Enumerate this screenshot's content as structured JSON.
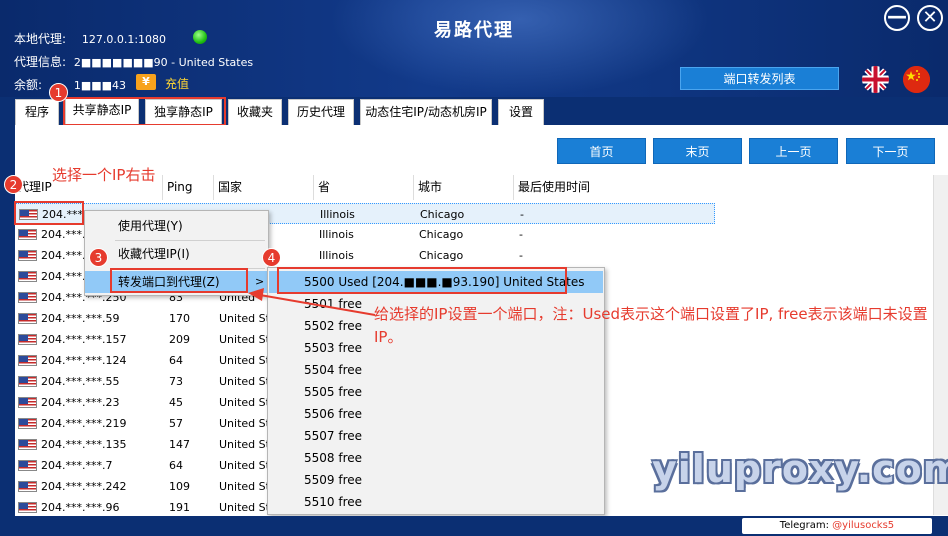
{
  "header": {
    "title": "易路代理",
    "local_proxy_label": "本地代理:",
    "local_proxy_value": "127.0.0.1:1080",
    "proxy_info_label": "代理信息:",
    "proxy_info_value": "2■■■■■■■90 - United States",
    "balance_label": "余额:",
    "balance_value": "1■■■43",
    "coin_symbol": "¥",
    "recharge": "充值",
    "port_forward_list": "端口转发列表",
    "minimize": "—",
    "close": "✕"
  },
  "tabs": [
    "程序",
    "共享静态IP",
    "独享静态IP",
    "收藏夹",
    "历史代理",
    "动态住宅IP/动态机房IP",
    "设置"
  ],
  "pagination": [
    "首页",
    "末页",
    "上一页",
    "下一页"
  ],
  "hint": "选择一个IP右击",
  "columns": [
    "代理IP",
    "Ping",
    "国家",
    "省",
    "城市",
    "最后使用时间"
  ],
  "rows": [
    {
      "ip": "204.***",
      "ping": "",
      "country": "es",
      "state": "Illinois",
      "city": "Chicago",
      "last": "-"
    },
    {
      "ip": "204.***.",
      "ping": "",
      "country": "es",
      "state": "Illinois",
      "city": "Chicago",
      "last": "-"
    },
    {
      "ip": "204.***.",
      "ping": "",
      "country": "es",
      "state": "Illinois",
      "city": "Chicago",
      "last": "-"
    },
    {
      "ip": "204.***.",
      "ping": "",
      "country": "",
      "state": "",
      "city": "",
      "last": ""
    },
    {
      "ip": "204.***.***.250",
      "ping": "83",
      "country": "United",
      "state": "",
      "city": "",
      "last": ""
    },
    {
      "ip": "204.***.***.59",
      "ping": "170",
      "country": "United Sta",
      "state": "",
      "city": "",
      "last": ""
    },
    {
      "ip": "204.***.***.157",
      "ping": "209",
      "country": "United Sta",
      "state": "",
      "city": "",
      "last": ""
    },
    {
      "ip": "204.***.***.124",
      "ping": "64",
      "country": "United Sta",
      "state": "",
      "city": "",
      "last": ""
    },
    {
      "ip": "204.***.***.55",
      "ping": "73",
      "country": "United Sta",
      "state": "",
      "city": "",
      "last": ""
    },
    {
      "ip": "204.***.***.23",
      "ping": "45",
      "country": "United Sta",
      "state": "",
      "city": "",
      "last": ""
    },
    {
      "ip": "204.***.***.219",
      "ping": "57",
      "country": "United Sta",
      "state": "",
      "city": "",
      "last": ""
    },
    {
      "ip": "204.***.***.135",
      "ping": "147",
      "country": "United Sta",
      "state": "",
      "city": "",
      "last": ""
    },
    {
      "ip": "204.***.***.7",
      "ping": "64",
      "country": "United Sta",
      "state": "",
      "city": "",
      "last": ""
    },
    {
      "ip": "204.***.***.242",
      "ping": "109",
      "country": "United Sta",
      "state": "",
      "city": "",
      "last": ""
    },
    {
      "ip": "204.***.***.96",
      "ping": "191",
      "country": "United Sta",
      "state": "",
      "city": "",
      "last": ""
    }
  ],
  "context_menu": {
    "items": [
      "使用代理(Y)",
      "收藏代理IP(I)",
      "转发端口到代理(Z)"
    ],
    "arrow": ">"
  },
  "submenu": [
    "5500 Used [204.■■■.■93.190] United States",
    "5501 free",
    "5502 free",
    "5503 free",
    "5504 free",
    "5505 free",
    "5506 free",
    "5507 free",
    "5508 free",
    "5509 free",
    "5510 free"
  ],
  "badges": [
    "1",
    "2",
    "3",
    "4"
  ],
  "annotation": "给选择的IP设置一个端口，注：Used表示这个端口设置了IP, free表示该端口未设置IP。",
  "watermark": "yiluproxy.com",
  "footer": {
    "telegram_label": "Telegram: ",
    "telegram_handle": "@yilusocks5"
  },
  "colors": {
    "header_bg": "#0a2a6c",
    "accent_blue": "#1a7fd6",
    "annotation_red": "#e63b2e",
    "menu_hover": "#91c9f7",
    "recharge_yellow": "#ffd633"
  }
}
